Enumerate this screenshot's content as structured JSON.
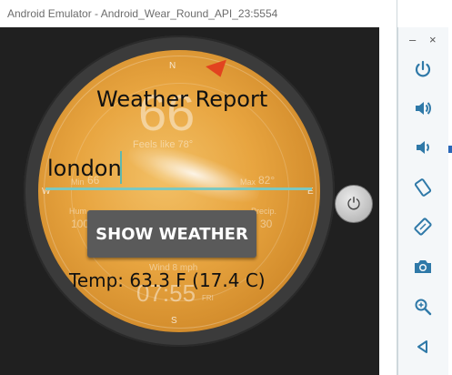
{
  "window": {
    "title": "Android Emulator - Android_Wear_Round_API_23:5554"
  },
  "watchface": {
    "compass": {
      "n": "N",
      "w": "W",
      "e": "E",
      "s": "S"
    },
    "ghost_temp": "66",
    "feels_like": "Feels like 78°",
    "min_label": "Min",
    "min_value": "66",
    "max_label": "Max",
    "max_value": "82°",
    "hum_label": "Hum",
    "hum_value": "100",
    "precip_label": "Precip.",
    "precip_value": "30",
    "wind": "Wind 8 mph",
    "time": "07:55",
    "day": "FRI"
  },
  "app": {
    "title": "Weather Report",
    "city_input_value": "london",
    "show_button_label": "SHOW WEATHER",
    "temperature_text": "Temp: 63.3 F (17.4 C)"
  },
  "toolbar": {
    "minimize": "–",
    "close": "×",
    "buttons": [
      {
        "name": "power-icon",
        "glyph": "⏻"
      },
      {
        "name": "volume-up-icon",
        "glyph": "🔊"
      },
      {
        "name": "volume-down-icon",
        "glyph": "🔉"
      },
      {
        "name": "rotate-left-icon",
        "glyph": "⟲"
      },
      {
        "name": "rotate-right-icon",
        "glyph": "⟳"
      },
      {
        "name": "camera-icon",
        "glyph": "📷"
      },
      {
        "name": "zoom-icon",
        "glyph": "🔍"
      },
      {
        "name": "back-icon",
        "glyph": "◁"
      }
    ]
  },
  "colors": {
    "accent": "#7cc8c0",
    "toolbar_icon": "#2f79a8",
    "face_orange": "#e8a540"
  }
}
